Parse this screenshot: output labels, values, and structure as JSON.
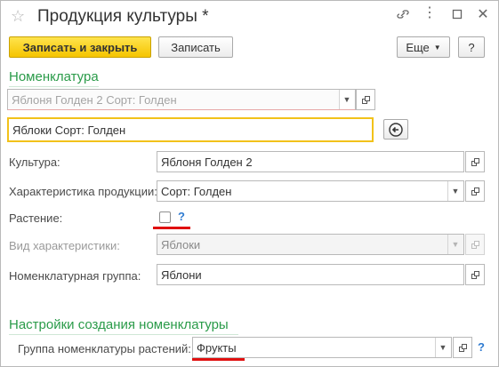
{
  "window": {
    "title": "Продукция культуры *",
    "icons": [
      "star-icon",
      "link-icon",
      "more-icon",
      "maximize-icon",
      "close-icon"
    ]
  },
  "toolbar": {
    "save_close_label": "Записать и закрыть",
    "save_label": "Записать",
    "more_label": "Еще",
    "help_label": "?"
  },
  "section_nomenclature": {
    "title": "Номенклатура",
    "linked_value": "Яблоня Голден 2 Сорт: Голден",
    "selected_value": "Яблоки Сорт: Голден"
  },
  "fields": {
    "culture": {
      "label": "Культура:",
      "value": "Яблоня Голден 2"
    },
    "product_characteristic": {
      "label": "Характеристика продукции:",
      "value": "Сорт: Голден"
    },
    "plant": {
      "label": "Растение:",
      "checked": false,
      "help": "?"
    },
    "characteristic_kind": {
      "label": "Вид характеристики:",
      "value": "Яблоки"
    },
    "nomenclature_group": {
      "label": "Номенклатурная группа:",
      "value": "Яблони"
    }
  },
  "section_settings": {
    "title": "Настройки создания номенклатуры",
    "plant_group_label": "Группа номенклатуры растений:",
    "plant_group_value": "Фрукты",
    "help": "?"
  },
  "colors": {
    "accent_green": "#2a9b49",
    "primary_button": "#f5c400",
    "focus_border": "#f2c21a",
    "annotation_red": "#e01010",
    "help_blue": "#2f7bd1"
  }
}
